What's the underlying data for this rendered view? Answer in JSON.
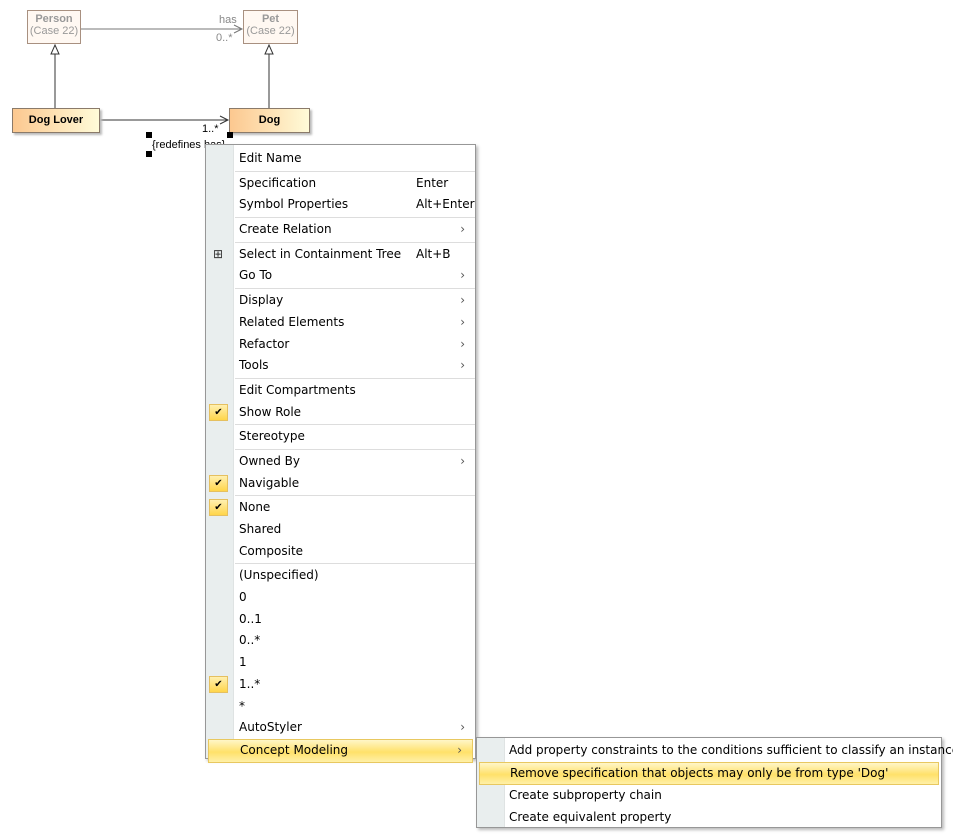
{
  "diagram": {
    "person": {
      "name": "Person",
      "sub": "(Case 22)"
    },
    "pet": {
      "name": "Pet",
      "sub": "(Case 22)"
    },
    "dog_lover": {
      "name": "Dog Lover"
    },
    "dog": {
      "name": "Dog"
    },
    "has_label": "has",
    "has_mult": "0..*",
    "dog_mult": "1..*",
    "redefines": "{redefines has}"
  },
  "menu": {
    "items": [
      {
        "label": "Edit Name"
      },
      {
        "sep": true
      },
      {
        "label": "Specification",
        "shortcut": "Enter"
      },
      {
        "label": "Symbol Properties",
        "shortcut": "Alt+Enter"
      },
      {
        "sep": true
      },
      {
        "label": "Create Relation",
        "submenu": true
      },
      {
        "sep": true
      },
      {
        "label": "Select in Containment Tree",
        "shortcut": "Alt+B",
        "icon": "containment-tree-icon"
      },
      {
        "label": "Go To",
        "submenu": true
      },
      {
        "sep": true
      },
      {
        "label": "Display",
        "submenu": true
      },
      {
        "label": "Related Elements",
        "submenu": true
      },
      {
        "label": "Refactor",
        "submenu": true
      },
      {
        "label": "Tools",
        "submenu": true
      },
      {
        "sep": true
      },
      {
        "label": "Edit Compartments"
      },
      {
        "label": "Show Role",
        "checked": true
      },
      {
        "sep": true
      },
      {
        "label": "Stereotype"
      },
      {
        "sep": true
      },
      {
        "label": "Owned By",
        "submenu": true
      },
      {
        "label": "Navigable",
        "checked": true
      },
      {
        "sep": true
      },
      {
        "label": "None",
        "checked": true
      },
      {
        "label": "Shared"
      },
      {
        "label": "Composite"
      },
      {
        "sep": true
      },
      {
        "label": "(Unspecified)"
      },
      {
        "label": "0"
      },
      {
        "label": "0..1"
      },
      {
        "label": "0..*"
      },
      {
        "label": "1"
      },
      {
        "label": "1..*",
        "checked": true
      },
      {
        "label": "*"
      },
      {
        "label": "AutoStyler",
        "submenu": true
      },
      {
        "label": "Concept Modeling",
        "submenu": true,
        "highlighted": true
      }
    ]
  },
  "submenu": {
    "items": [
      {
        "label": "Add property constraints to the conditions sufficient to classify an instance."
      },
      {
        "label": "Remove specification that objects may only be from type 'Dog'",
        "highlighted": true
      },
      {
        "label": "Create subproperty chain"
      },
      {
        "label": "Create equivalent property"
      }
    ]
  },
  "colors": {
    "highlight": "#ffe16a",
    "gutter": "#e9eeee",
    "class_fill": "#fcc890"
  }
}
